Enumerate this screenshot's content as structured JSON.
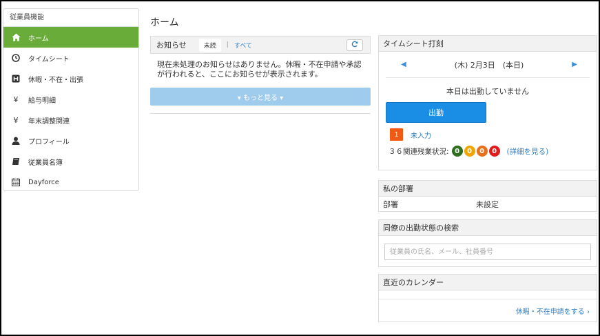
{
  "sidebar": {
    "header": "従業員機能",
    "items": [
      {
        "label": "ホーム",
        "icon": "home-icon",
        "active": true
      },
      {
        "label": "タイムシート",
        "icon": "clock-icon",
        "active": false
      },
      {
        "label": "休暇・不在・出張",
        "icon": "leave-h-icon",
        "active": false
      },
      {
        "label": "給与明細",
        "icon": "yen-icon",
        "active": false
      },
      {
        "label": "年末調整関連",
        "icon": "yen-icon",
        "active": false
      },
      {
        "label": "プロフィール",
        "icon": "user-icon",
        "active": false
      },
      {
        "label": "従業員名簿",
        "icon": "book-icon",
        "active": false
      },
      {
        "label": "Dayforce",
        "icon": "calendar-icon",
        "active": false
      }
    ]
  },
  "page": {
    "title": "ホーム"
  },
  "notice": {
    "title": "お知らせ",
    "tab_unread": "未読",
    "tab_sep": "|",
    "tab_all": "すべて",
    "message": "現在未処理のお知らせはありません。休暇・不在申請や承認が行われると、ここにお知らせが表示されます。",
    "more": "▾ もっと見る ▾"
  },
  "timesheet": {
    "title": "タイムシート打刻",
    "date": "(木) 2月3日　(本日)",
    "status": "本日は出勤していません",
    "clock_in": "出勤",
    "uninput_count": "1",
    "uninput_label": "未入力",
    "ot_label": "３６関連残業状況:",
    "ot_values": [
      "0",
      "0",
      "0",
      "0"
    ],
    "ot_colors": [
      "#2f6e1f",
      "#f0a500",
      "#e8701a",
      "#e01c1c"
    ],
    "ot_detail": "(詳細を見る)"
  },
  "dept": {
    "title": "私の部署",
    "key": "部署",
    "value": "未設定"
  },
  "colleague": {
    "title": "同僚の出勤状態の検索",
    "placeholder": "従業員の氏名、メール、社員番号"
  },
  "calendar": {
    "title": "直近のカレンダー",
    "link": "休暇・不在申請をする ›"
  },
  "colors": {
    "active": "#6aac3a",
    "primary": "#1a8ee4",
    "link": "#2f7fc1",
    "more": "#9fcbec",
    "badge": "#f05a14"
  }
}
